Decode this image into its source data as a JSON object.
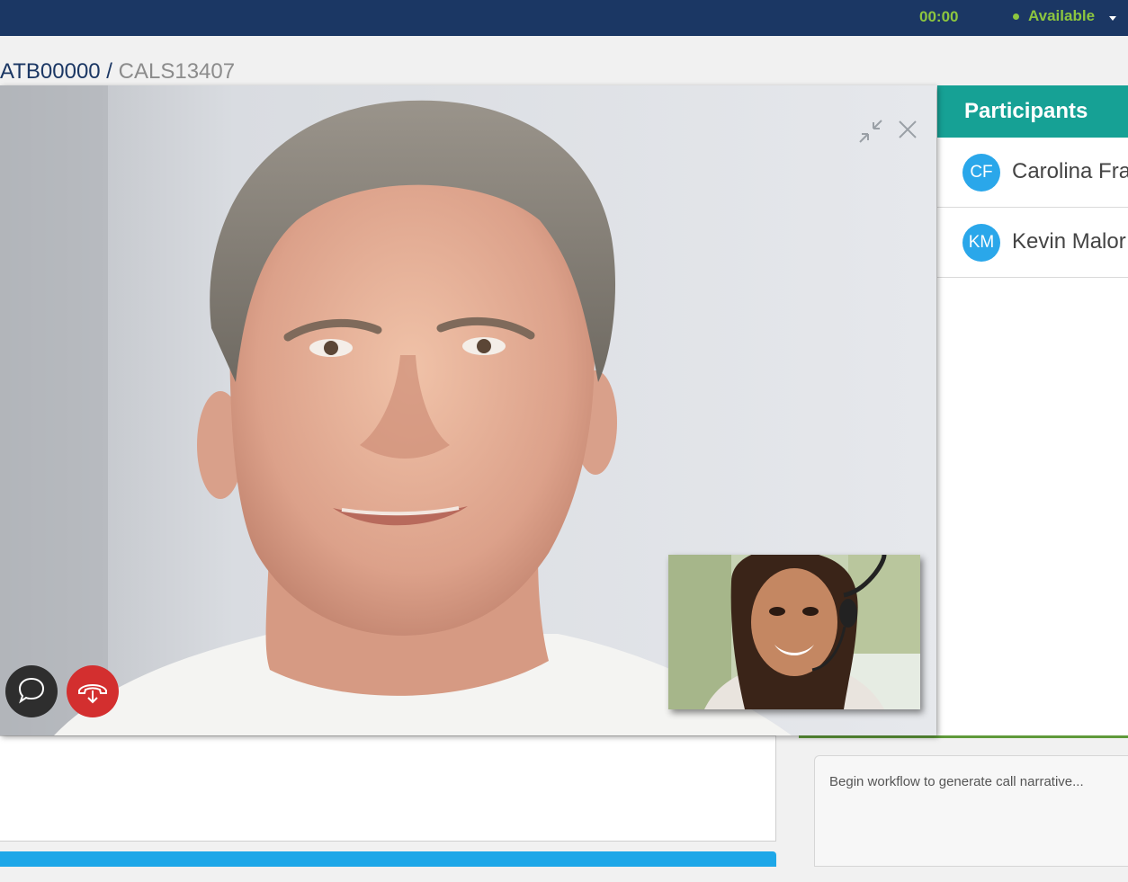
{
  "topbar": {
    "timer": "00:00",
    "status": "Available",
    "colors": {
      "background": "#1b3764",
      "accent": "#8dc63f"
    }
  },
  "breadcrumb": {
    "primary": "ATB00000",
    "separator": " / ",
    "secondary": "CALS13407"
  },
  "video": {
    "controls": {
      "minimize_icon": "minimize-arrows-icon",
      "close_icon": "close-icon",
      "chat_icon": "chat-bubble-icon",
      "hangup_icon": "hang-up-phone-icon"
    },
    "colors": {
      "hangup": "#d32f2f",
      "chat": "#2e2e2e"
    }
  },
  "participants": {
    "title": "Participants",
    "items": [
      {
        "initials": "CF",
        "name": "Carolina Fra"
      },
      {
        "initials": "KM",
        "name": "Kevin Malor"
      }
    ],
    "colors": {
      "header": "#16a195",
      "avatar": "#2aa7ea"
    }
  },
  "narrative": {
    "placeholder": "Begin workflow to generate call narrative..."
  }
}
